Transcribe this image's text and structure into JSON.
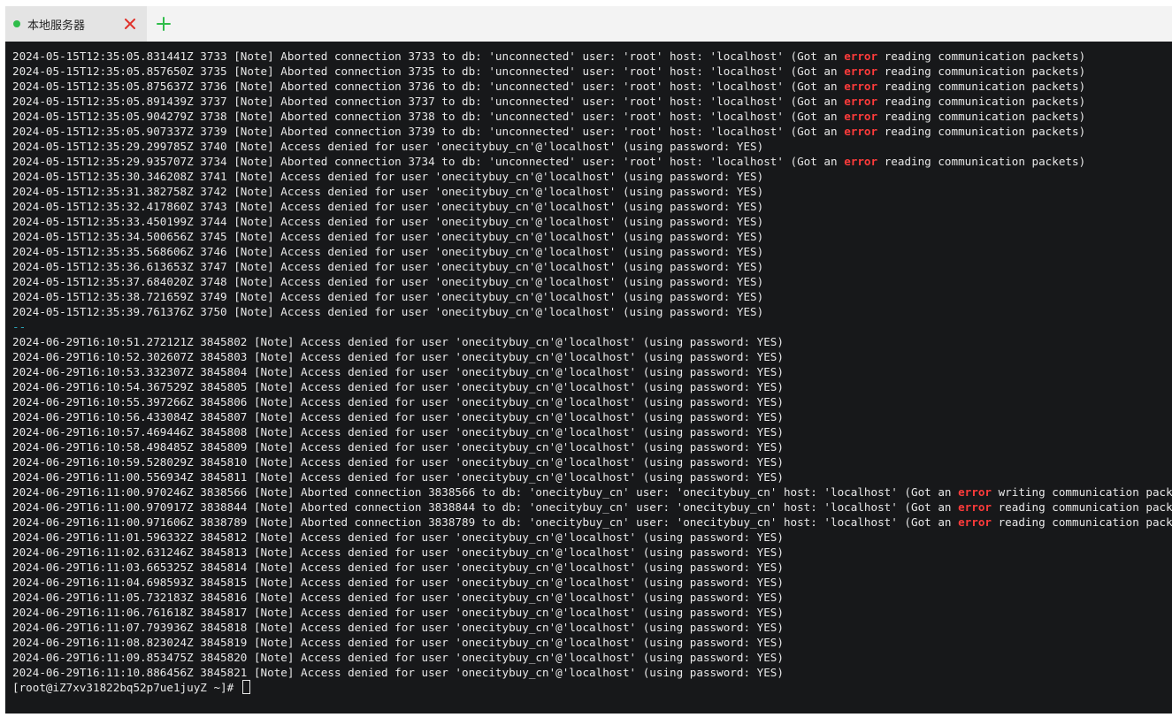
{
  "tabs": [
    {
      "title": "本地服务器",
      "status_color": "#2fbd4a"
    }
  ],
  "icons": {
    "tab_status": "green-dot-icon",
    "close": "close-icon",
    "add": "plus-icon"
  },
  "colors": {
    "terminal_bg": "#17181a",
    "text": "#e8e8e8",
    "error": "#ff3b3b",
    "separator": "#2aa3b6"
  },
  "log_lines": [
    [
      "2024-05-15T12:35:05.831441Z 3733 [Note] Aborted connection 3733 to db: 'unconnected' user: 'root' host: 'localhost' (Got an ",
      "error",
      " reading communication packets)"
    ],
    [
      "2024-05-15T12:35:05.857650Z 3735 [Note] Aborted connection 3735 to db: 'unconnected' user: 'root' host: 'localhost' (Got an ",
      "error",
      " reading communication packets)"
    ],
    [
      "2024-05-15T12:35:05.875637Z 3736 [Note] Aborted connection 3736 to db: 'unconnected' user: 'root' host: 'localhost' (Got an ",
      "error",
      " reading communication packets)"
    ],
    [
      "2024-05-15T12:35:05.891439Z 3737 [Note] Aborted connection 3737 to db: 'unconnected' user: 'root' host: 'localhost' (Got an ",
      "error",
      " reading communication packets)"
    ],
    [
      "2024-05-15T12:35:05.904279Z 3738 [Note] Aborted connection 3738 to db: 'unconnected' user: 'root' host: 'localhost' (Got an ",
      "error",
      " reading communication packets)"
    ],
    [
      "2024-05-15T12:35:05.907337Z 3739 [Note] Aborted connection 3739 to db: 'unconnected' user: 'root' host: 'localhost' (Got an ",
      "error",
      " reading communication packets)"
    ],
    [
      "2024-05-15T12:35:29.299785Z 3740 [Note] Access denied for user 'onecitybuy_cn'@'localhost' (using password: YES)"
    ],
    [
      "2024-05-15T12:35:29.935707Z 3734 [Note] Aborted connection 3734 to db: 'unconnected' user: 'root' host: 'localhost' (Got an ",
      "error",
      " reading communication packets)"
    ],
    [
      "2024-05-15T12:35:30.346208Z 3741 [Note] Access denied for user 'onecitybuy_cn'@'localhost' (using password: YES)"
    ],
    [
      "2024-05-15T12:35:31.382758Z 3742 [Note] Access denied for user 'onecitybuy_cn'@'localhost' (using password: YES)"
    ],
    [
      "2024-05-15T12:35:32.417860Z 3743 [Note] Access denied for user 'onecitybuy_cn'@'localhost' (using password: YES)"
    ],
    [
      "2024-05-15T12:35:33.450199Z 3744 [Note] Access denied for user 'onecitybuy_cn'@'localhost' (using password: YES)"
    ],
    [
      "2024-05-15T12:35:34.500656Z 3745 [Note] Access denied for user 'onecitybuy_cn'@'localhost' (using password: YES)"
    ],
    [
      "2024-05-15T12:35:35.568606Z 3746 [Note] Access denied for user 'onecitybuy_cn'@'localhost' (using password: YES)"
    ],
    [
      "2024-05-15T12:35:36.613653Z 3747 [Note] Access denied for user 'onecitybuy_cn'@'localhost' (using password: YES)"
    ],
    [
      "2024-05-15T12:35:37.684020Z 3748 [Note] Access denied for user 'onecitybuy_cn'@'localhost' (using password: YES)"
    ],
    [
      "2024-05-15T12:35:38.721659Z 3749 [Note] Access denied for user 'onecitybuy_cn'@'localhost' (using password: YES)"
    ],
    [
      "2024-05-15T12:35:39.761376Z 3750 [Note] Access denied for user 'onecitybuy_cn'@'localhost' (using password: YES)"
    ],
    [
      "--"
    ],
    [
      "2024-06-29T16:10:51.272121Z 3845802 [Note] Access denied for user 'onecitybuy_cn'@'localhost' (using password: YES)"
    ],
    [
      "2024-06-29T16:10:52.302607Z 3845803 [Note] Access denied for user 'onecitybuy_cn'@'localhost' (using password: YES)"
    ],
    [
      "2024-06-29T16:10:53.332307Z 3845804 [Note] Access denied for user 'onecitybuy_cn'@'localhost' (using password: YES)"
    ],
    [
      "2024-06-29T16:10:54.367529Z 3845805 [Note] Access denied for user 'onecitybuy_cn'@'localhost' (using password: YES)"
    ],
    [
      "2024-06-29T16:10:55.397266Z 3845806 [Note] Access denied for user 'onecitybuy_cn'@'localhost' (using password: YES)"
    ],
    [
      "2024-06-29T16:10:56.433084Z 3845807 [Note] Access denied for user 'onecitybuy_cn'@'localhost' (using password: YES)"
    ],
    [
      "2024-06-29T16:10:57.469446Z 3845808 [Note] Access denied for user 'onecitybuy_cn'@'localhost' (using password: YES)"
    ],
    [
      "2024-06-29T16:10:58.498485Z 3845809 [Note] Access denied for user 'onecitybuy_cn'@'localhost' (using password: YES)"
    ],
    [
      "2024-06-29T16:10:59.528029Z 3845810 [Note] Access denied for user 'onecitybuy_cn'@'localhost' (using password: YES)"
    ],
    [
      "2024-06-29T16:11:00.556934Z 3845811 [Note] Access denied for user 'onecitybuy_cn'@'localhost' (using password: YES)"
    ],
    [
      "2024-06-29T16:11:00.970246Z 3838566 [Note] Aborted connection 3838566 to db: 'onecitybuy_cn' user: 'onecitybuy_cn' host: 'localhost' (Got an ",
      "error",
      " writing communication packets)"
    ],
    [
      "2024-06-29T16:11:00.970917Z 3838844 [Note] Aborted connection 3838844 to db: 'onecitybuy_cn' user: 'onecitybuy_cn' host: 'localhost' (Got an ",
      "error",
      " reading communication packets)"
    ],
    [
      "2024-06-29T16:11:00.971606Z 3838789 [Note] Aborted connection 3838789 to db: 'onecitybuy_cn' user: 'onecitybuy_cn' host: 'localhost' (Got an ",
      "error",
      " reading communication packets)"
    ],
    [
      "2024-06-29T16:11:01.596332Z 3845812 [Note] Access denied for user 'onecitybuy_cn'@'localhost' (using password: YES)"
    ],
    [
      "2024-06-29T16:11:02.631246Z 3845813 [Note] Access denied for user 'onecitybuy_cn'@'localhost' (using password: YES)"
    ],
    [
      "2024-06-29T16:11:03.665325Z 3845814 [Note] Access denied for user 'onecitybuy_cn'@'localhost' (using password: YES)"
    ],
    [
      "2024-06-29T16:11:04.698593Z 3845815 [Note] Access denied for user 'onecitybuy_cn'@'localhost' (using password: YES)"
    ],
    [
      "2024-06-29T16:11:05.732183Z 3845816 [Note] Access denied for user 'onecitybuy_cn'@'localhost' (using password: YES)"
    ],
    [
      "2024-06-29T16:11:06.761618Z 3845817 [Note] Access denied for user 'onecitybuy_cn'@'localhost' (using password: YES)"
    ],
    [
      "2024-06-29T16:11:07.793936Z 3845818 [Note] Access denied for user 'onecitybuy_cn'@'localhost' (using password: YES)"
    ],
    [
      "2024-06-29T16:11:08.823024Z 3845819 [Note] Access denied for user 'onecitybuy_cn'@'localhost' (using password: YES)"
    ],
    [
      "2024-06-29T16:11:09.853475Z 3845820 [Note] Access denied for user 'onecitybuy_cn'@'localhost' (using password: YES)"
    ],
    [
      "2024-06-29T16:11:10.886456Z 3845821 [Note] Access denied for user 'onecitybuy_cn'@'localhost' (using password: YES)"
    ]
  ],
  "prompt": "[root@iZ7xv31822bq52p7ue1juyZ ~]# "
}
